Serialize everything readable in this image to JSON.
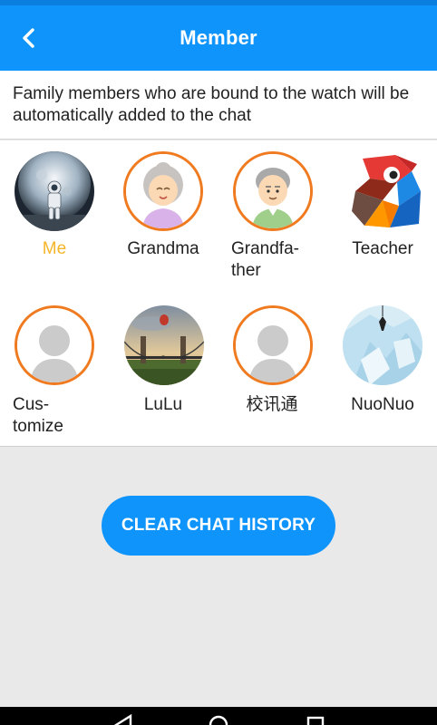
{
  "header": {
    "title": "Member",
    "back_icon": "chevron-left-icon"
  },
  "info_text": "Family members who are bound to the watch will be automatically added to the chat",
  "members": [
    {
      "name": "Me",
      "highlight": true
    },
    {
      "name": "Grandma"
    },
    {
      "name": "Grandfa-\nther"
    },
    {
      "name": "Teacher"
    },
    {
      "name": "Cus-\ntomize"
    },
    {
      "name": "LuLu"
    },
    {
      "name": "校讯通"
    },
    {
      "name": "NuoNuo"
    }
  ],
  "actions": {
    "clear_label": "CLEAR CHAT HISTORY"
  },
  "colors": {
    "primary": "#0f94fb",
    "accent_ring": "#f07a1f",
    "me_label": "#f5b52a"
  },
  "navbar": {
    "icons": [
      "back-triangle-icon",
      "home-circle-icon",
      "recents-square-icon"
    ]
  }
}
